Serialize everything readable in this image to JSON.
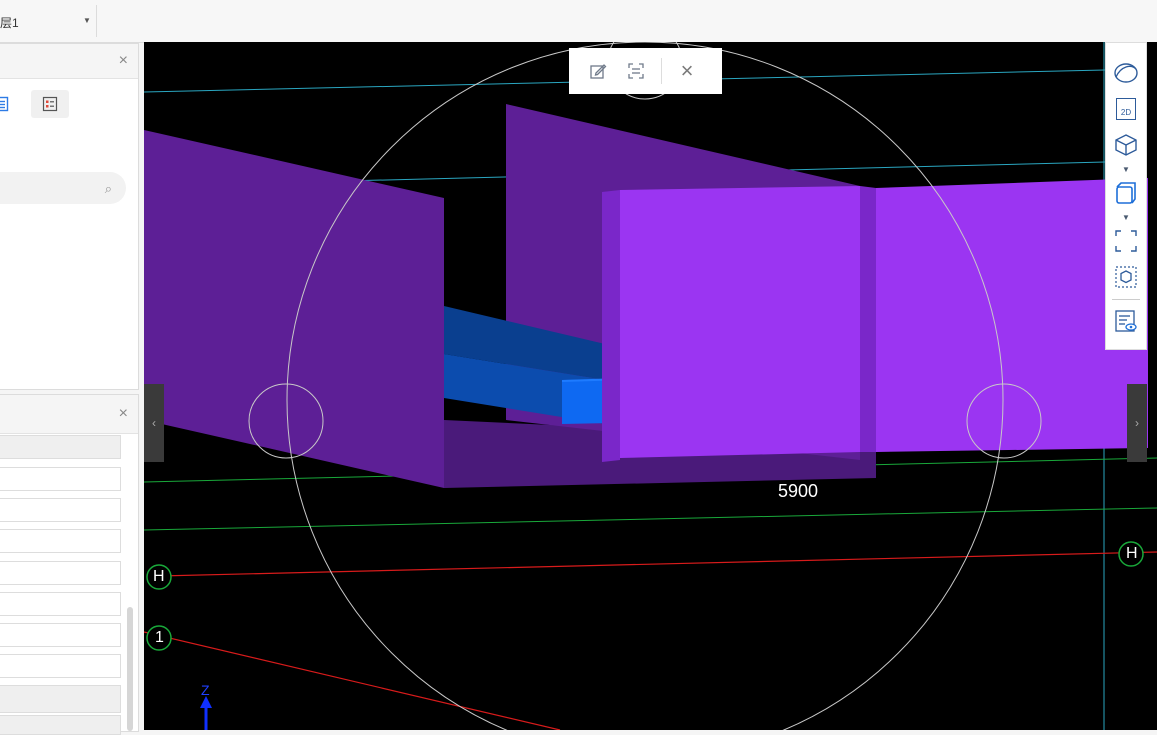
{
  "floor_select": {
    "value": "层1"
  },
  "panels": {
    "top": {
      "close": "×"
    },
    "bottom": {
      "close": "×"
    }
  },
  "float_toolbar": {
    "close": "×"
  },
  "right_toolbar": {
    "view2d_label": "2D"
  },
  "viewport": {
    "dimension_label": "5900",
    "grid_labels": [
      "H",
      "1",
      "H"
    ],
    "axis_label": "Z",
    "colors": {
      "background": "#000000",
      "purple_front": "#9b35f2",
      "purple_side": "#5d1f96",
      "blue_bar": "#0e69f2",
      "grid_cyan": "#2aa6c0",
      "grid_green": "#19a83a",
      "grid_red": "#d81b1b"
    }
  }
}
